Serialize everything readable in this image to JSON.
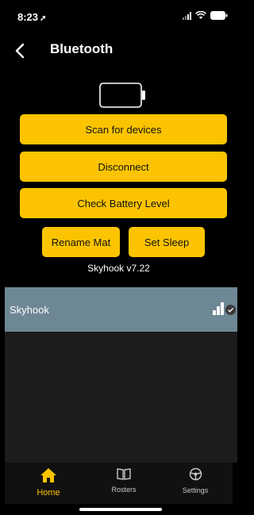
{
  "status_bar": {
    "time": "8:23",
    "location_arrow": "➚"
  },
  "nav": {
    "back_icon": "chevron-left-icon",
    "title": "Bluetooth"
  },
  "battery_icon": "battery-empty-icon",
  "buttons": {
    "scan": "Scan for devices",
    "disconnect": "Disconnect",
    "check_battery": "Check Battery Level",
    "rename": "Rename Mat",
    "set_sleep": "Set Sleep"
  },
  "version": "Skyhook v7.22",
  "devices": [
    {
      "name": "Skyhook",
      "connected": true,
      "signal_icon": "signal-bars-icon"
    }
  ],
  "tabs": [
    {
      "label": "Home",
      "icon": "home-icon",
      "active": true
    },
    {
      "label": "Rosters",
      "icon": "book-icon",
      "active": false
    },
    {
      "label": "Settings",
      "icon": "steering-wheel-icon",
      "active": false
    }
  ],
  "colors": {
    "accent": "#fcc400",
    "device_row": "#6e8795",
    "background": "#000000"
  }
}
